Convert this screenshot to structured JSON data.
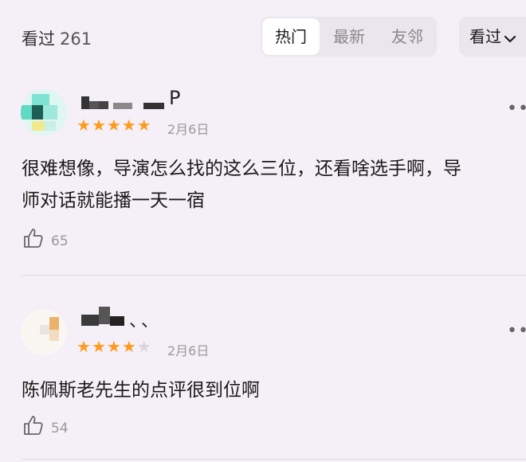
{
  "header": {
    "seen_label": "看过",
    "seen_count": "261",
    "tabs": [
      {
        "label": "热门",
        "active": true
      },
      {
        "label": "最新",
        "active": false
      },
      {
        "label": "友邻",
        "active": false
      }
    ],
    "sort_label": "看过",
    "sort_icon": "chevron-down-icon"
  },
  "reviews": [
    {
      "username_visible": "P",
      "rating": 5,
      "max_rating": 5,
      "date": "2月6日",
      "content_lines": [
        "很难想像，导演怎么找的这么三位，还看啥选手啊，导",
        "师对话就能播一天一宿"
      ],
      "likes": "65",
      "more_icon": "more-dots-icon",
      "like_icon": "thumbs-up-icon"
    },
    {
      "username_visible": "、、",
      "rating": 4,
      "max_rating": 5,
      "date": "2月6日",
      "content_lines": [
        "陈佩斯老先生的点评很到位啊"
      ],
      "likes": "54",
      "more_icon": "more-dots-icon",
      "like_icon": "thumbs-up-icon"
    }
  ],
  "colors": {
    "background": "#f5f0f7",
    "star_on": "#ff9a1e",
    "star_off": "#d8d4dc",
    "muted_text": "#999999"
  }
}
